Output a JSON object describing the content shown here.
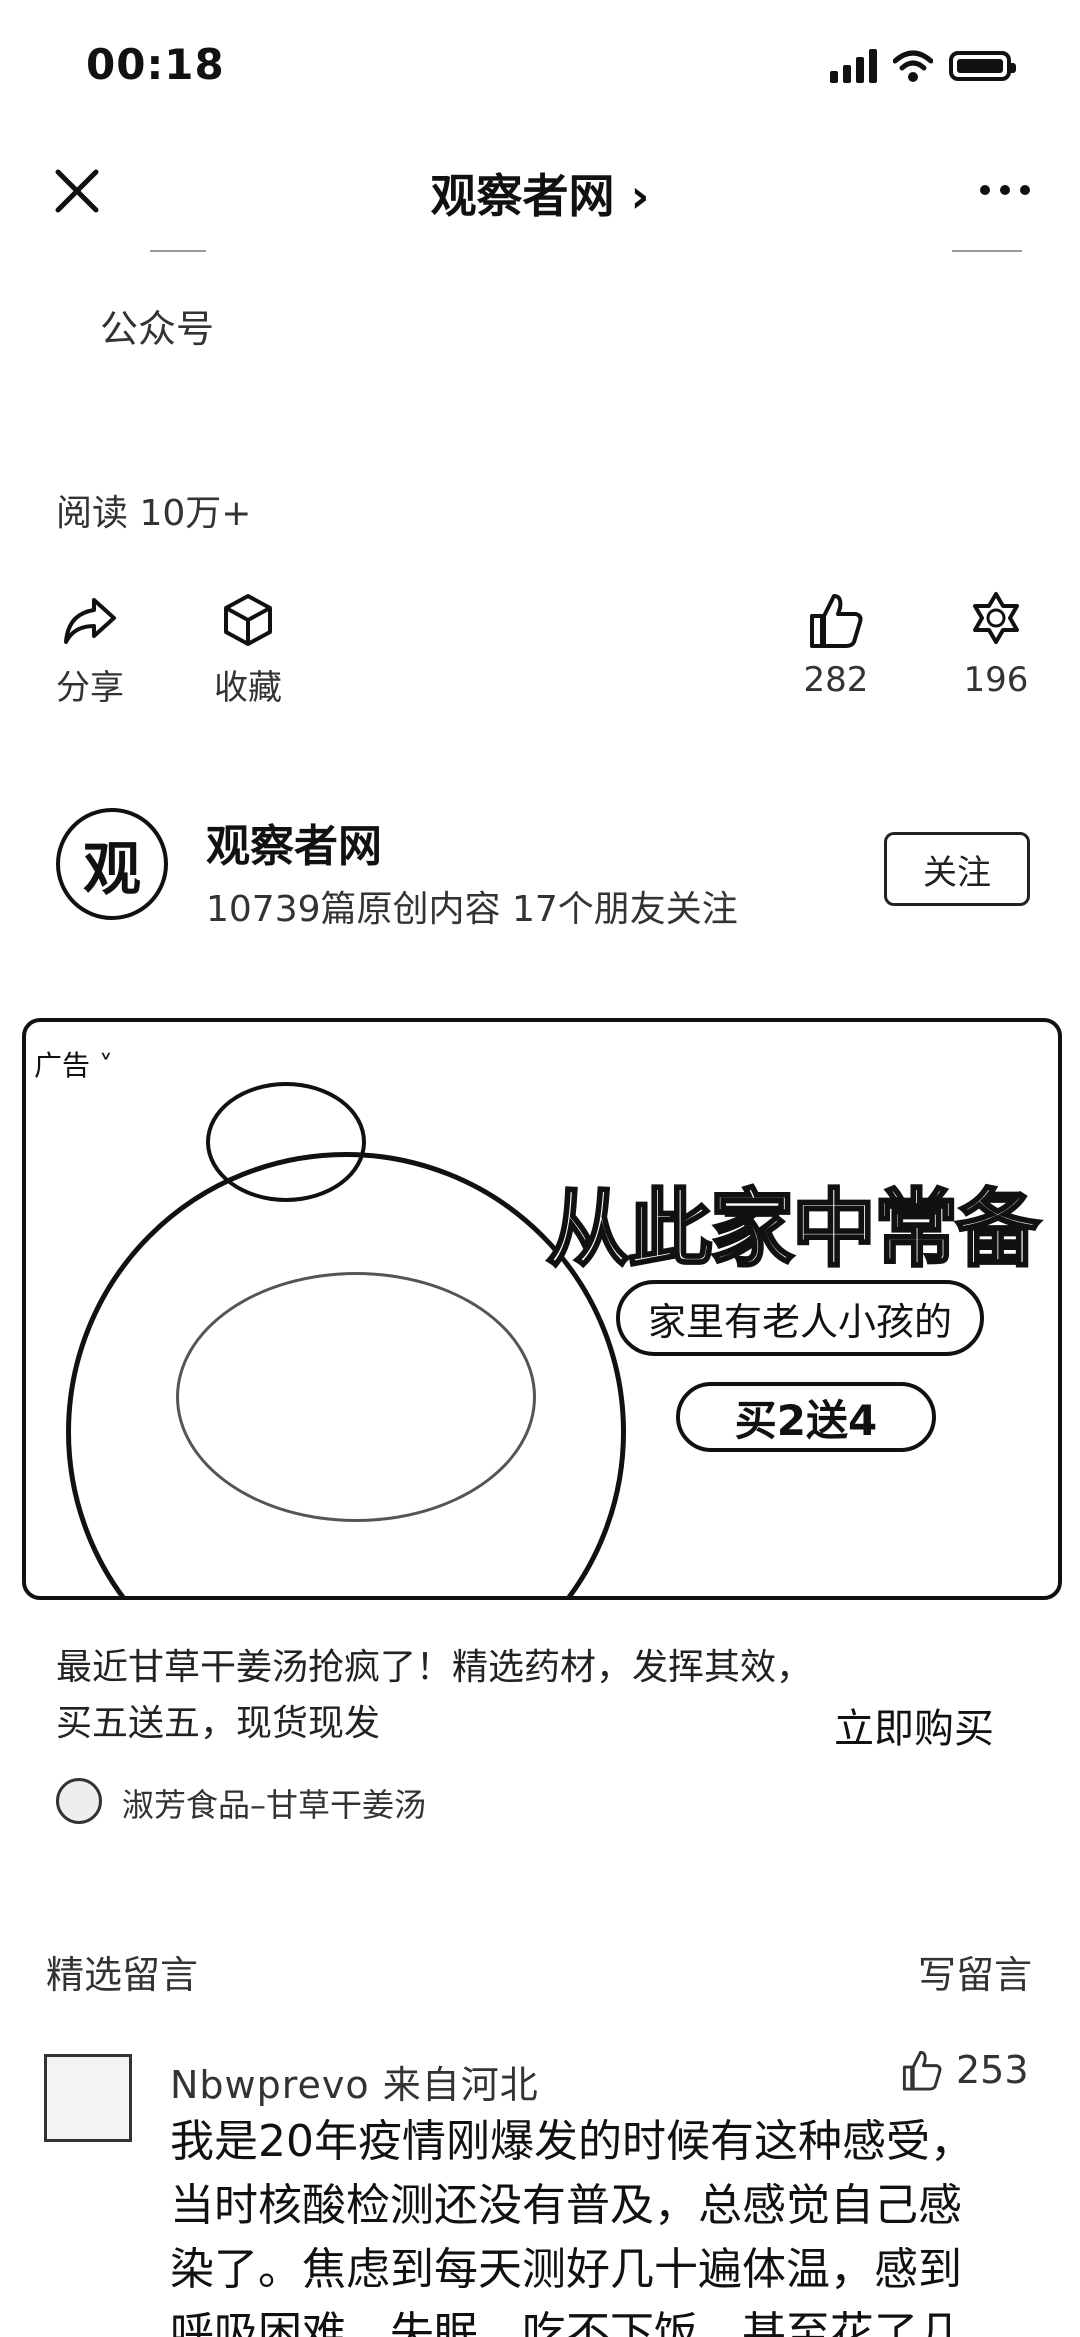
{
  "status_bar": {
    "time": "00:18"
  },
  "nav": {
    "title": "观察者网 ›"
  },
  "article": {
    "source_label": "公众号",
    "read_count": "阅读 10万+"
  },
  "actions": {
    "share": "分享",
    "favorite": "收藏",
    "like_count": "282",
    "wow_count": "196"
  },
  "account": {
    "avatar_char": "观",
    "name": "观察者网",
    "stats": "10739篇原创内容  17个朋友关注",
    "follow_label": "关注"
  },
  "ad": {
    "tag": "广告",
    "headline": "从此家中常备",
    "pill_text": "家里有老人小孩的",
    "offer": "买2送4",
    "description": "最近甘草干姜汤抢疯了！精选药材，发挥其效，买五送五，现货现发",
    "cta": "立即购买",
    "brand": "淑芳食品–甘草干姜汤"
  },
  "comments": {
    "section_title": "精选留言",
    "write_label": "写留言",
    "items": [
      {
        "user": "Nbwprevo 来自河北",
        "likes": "253",
        "lines": [
          "我是20年疫情刚爆发的时候有这种感受，",
          "当时核酸检测还没有普及，总感觉自己感",
          "染了。焦虑到每天测好几十遍体温，感到",
          "呼吸困难，失眠、吃不下饭，甚至花了几"
        ]
      }
    ]
  }
}
